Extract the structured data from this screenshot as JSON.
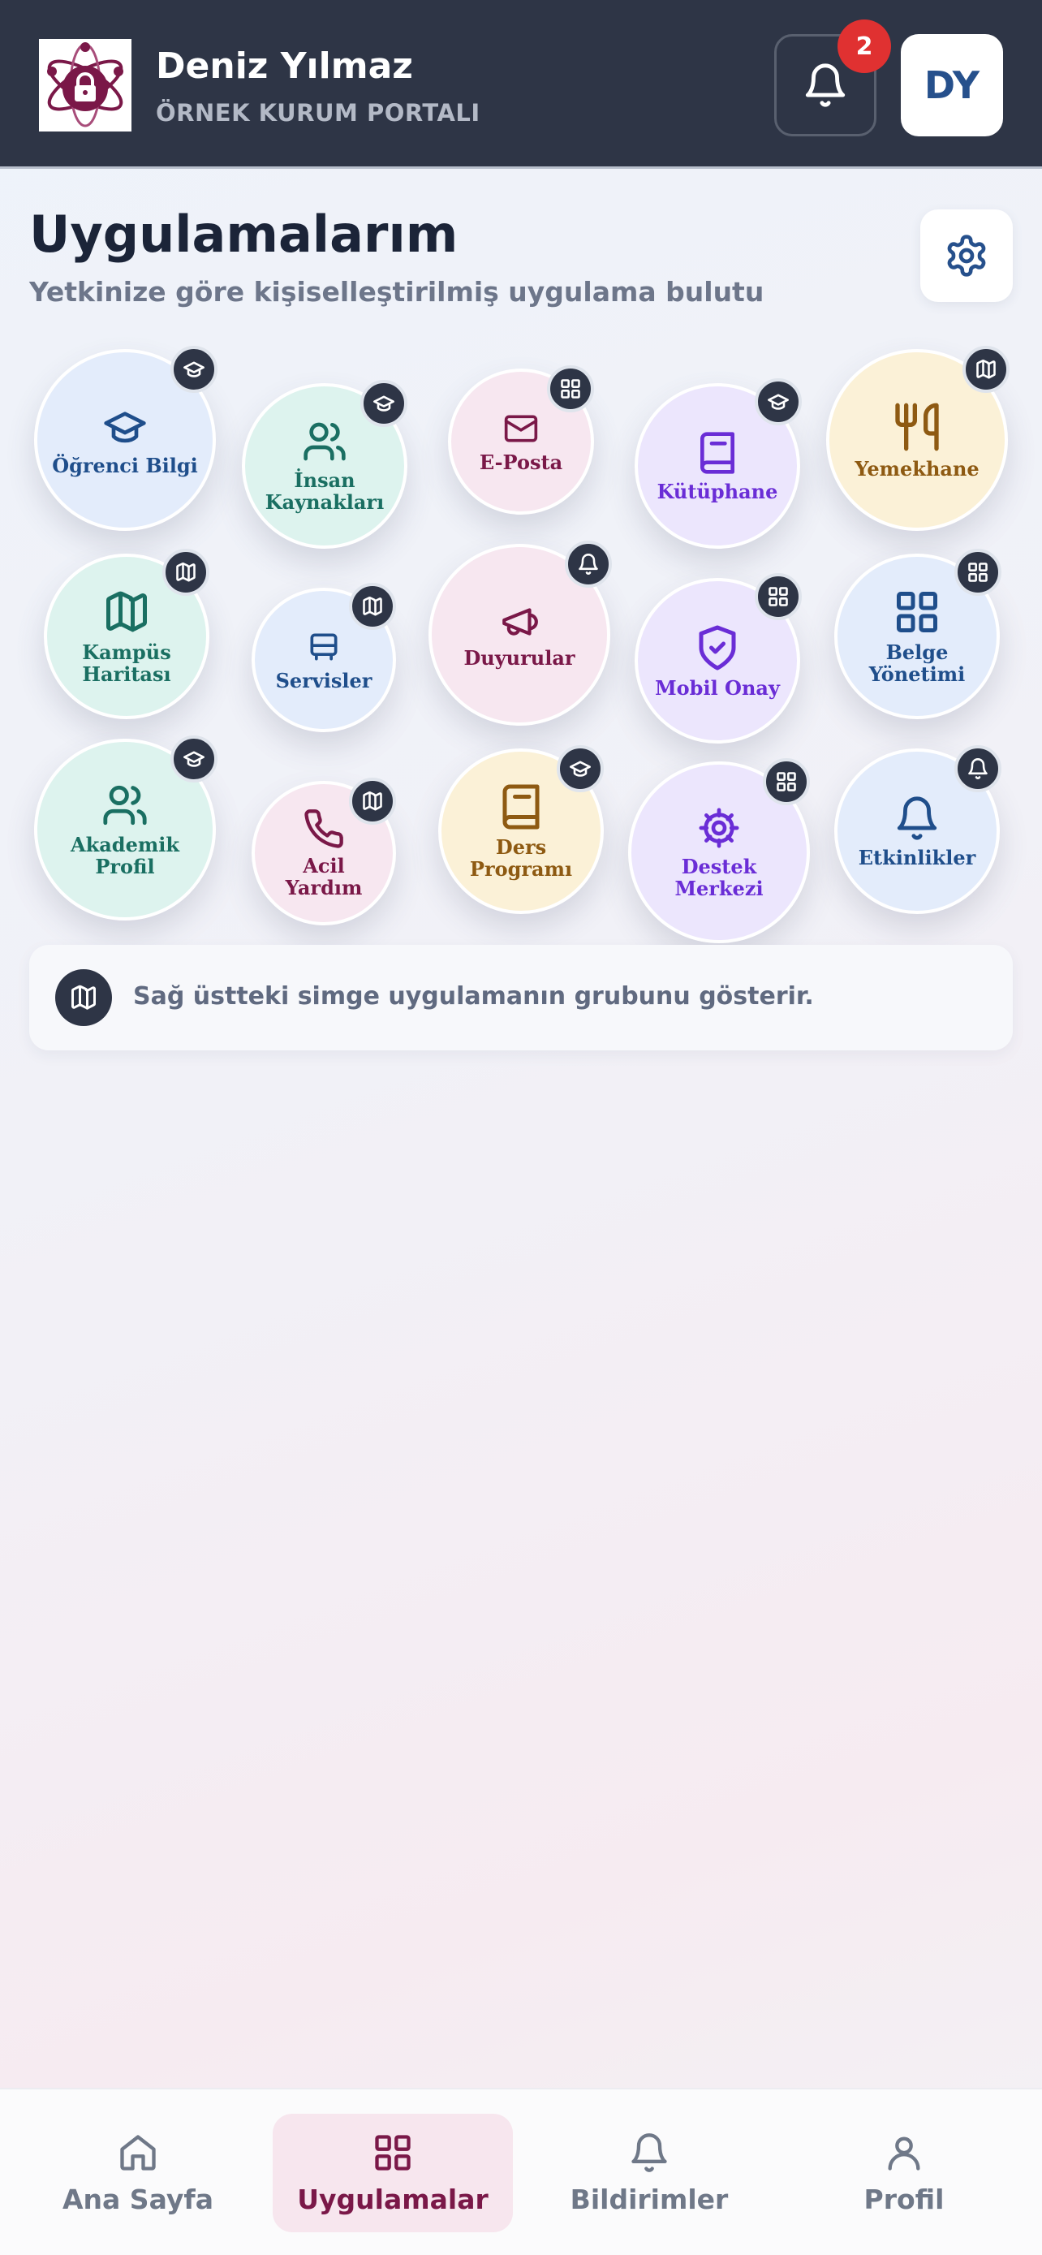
{
  "header": {
    "user_name": "Deniz Yılmaz",
    "portal_name": "ÖRNEK KURUM PORTALI",
    "notification_count": "2",
    "avatar_initials": "DY"
  },
  "page": {
    "title": "Uygulamalarım",
    "subtitle": "Yetkinize göre kişiselleştirilmiş uygulama bulutu"
  },
  "apps": [
    {
      "label": "Öğrenci Bilgi",
      "icon": "graduation-cap-icon",
      "group_icon": "graduation-cap-icon",
      "color": "blue"
    },
    {
      "label": "İnsan\nKaynakları",
      "icon": "users-icon",
      "group_icon": "graduation-cap-icon",
      "color": "teal"
    },
    {
      "label": "E-Posta",
      "icon": "mail-icon",
      "group_icon": "grid-icon",
      "color": "pink"
    },
    {
      "label": "Kütüphane",
      "icon": "book-icon",
      "group_icon": "graduation-cap-icon",
      "color": "purple"
    },
    {
      "label": "Yemekhane",
      "icon": "utensils-icon",
      "group_icon": "map-icon",
      "color": "yellow"
    },
    {
      "label": "Kampüs\nHaritası",
      "icon": "map-icon",
      "group_icon": "map-icon",
      "color": "teal"
    },
    {
      "label": "Servisler",
      "icon": "bus-icon",
      "group_icon": "map-icon",
      "color": "blue"
    },
    {
      "label": "Duyurular",
      "icon": "megaphone-icon",
      "group_icon": "bell-icon",
      "color": "pink"
    },
    {
      "label": "Mobil Onay",
      "icon": "shield-check-icon",
      "group_icon": "grid-icon",
      "color": "purple"
    },
    {
      "label": "Belge\nYönetimi",
      "icon": "grid-icon",
      "group_icon": "grid-icon",
      "color": "blue"
    },
    {
      "label": "Akademik\nProfil",
      "icon": "users-icon",
      "group_icon": "graduation-cap-icon",
      "color": "teal"
    },
    {
      "label": "Acil\nYardım",
      "icon": "phone-icon",
      "group_icon": "map-icon",
      "color": "pink"
    },
    {
      "label": "Ders\nProgramı",
      "icon": "book-icon",
      "group_icon": "graduation-cap-icon",
      "color": "yellow"
    },
    {
      "label": "Destek\nMerkezi",
      "icon": "gear-icon",
      "group_icon": "grid-icon",
      "color": "purple"
    },
    {
      "label": "Etkinlikler",
      "icon": "bell-icon",
      "group_icon": "bell-icon",
      "color": "blue"
    }
  ],
  "info": {
    "text": "Sağ üstteki simge uygulamanın grubunu gösterir.",
    "icon": "map-icon"
  },
  "nav": [
    {
      "label": "Ana Sayfa",
      "icon": "home-icon",
      "active": false
    },
    {
      "label": "Uygulamalar",
      "icon": "grid-icon",
      "active": true
    },
    {
      "label": "Bildirimler",
      "icon": "bell-icon",
      "active": false
    },
    {
      "label": "Profil",
      "icon": "user-icon",
      "active": false
    }
  ],
  "colors": {
    "header_bg": "#2e3546",
    "accent": "#7a1848",
    "badge": "#e03131"
  }
}
